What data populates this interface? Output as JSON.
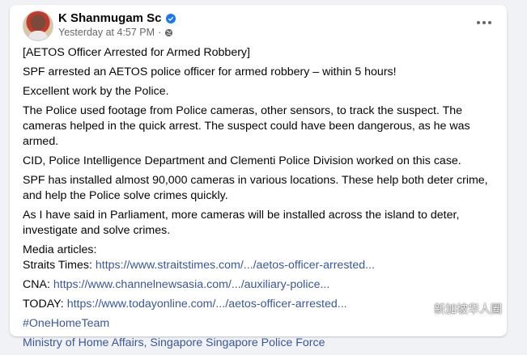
{
  "post": {
    "author": "K Shanmugam Sc",
    "timestamp": "Yesterday at 4:57 PM",
    "separator": "·",
    "paragraphs": [
      "[AETOS Officer Arrested for Armed Robbery]",
      "SPF arrested an AETOS police officer for armed robbery – within 5 hours!",
      "Excellent work by the Police.",
      "The Police used footage from Police cameras, other sensors, to track the suspect. The cameras helped in the quick arrest. The suspect could have been dangerous, as he was armed.",
      "CID, Police Intelligence Department and Clementi Police Division worked on this case.",
      "SPF has installed almost 90,000 cameras in various locations. These help both deter crime, and help the Police solve crimes quickly.",
      "As I have said in Parliament, more cameras will be installed across the island to deter, investigate and solve crimes."
    ],
    "media_heading": "Media articles:",
    "media": [
      {
        "source": "Straits Times:",
        "url": "https://www.straitstimes.com/.../aetos-officer-arrested..."
      },
      {
        "source": "CNA:",
        "url": "https://www.channelnewsasia.com/.../auxiliary-police..."
      },
      {
        "source": "TODAY:",
        "url": "https://www.todayonline.com/.../aetos-officer-arrested..."
      }
    ],
    "hashtag": "#OneHomeTeam",
    "tags": "Ministry of Home Affairs, Singapore Singapore Police Force"
  },
  "watermark": "新加坡华人圈",
  "icons": {
    "verified": "verified-badge-icon",
    "globe": "globe-icon",
    "more": "more-options-icon",
    "wechat": "wechat-icon"
  },
  "colors": {
    "link": "#385898",
    "verified": "#1877f2",
    "meta": "#65676b"
  }
}
